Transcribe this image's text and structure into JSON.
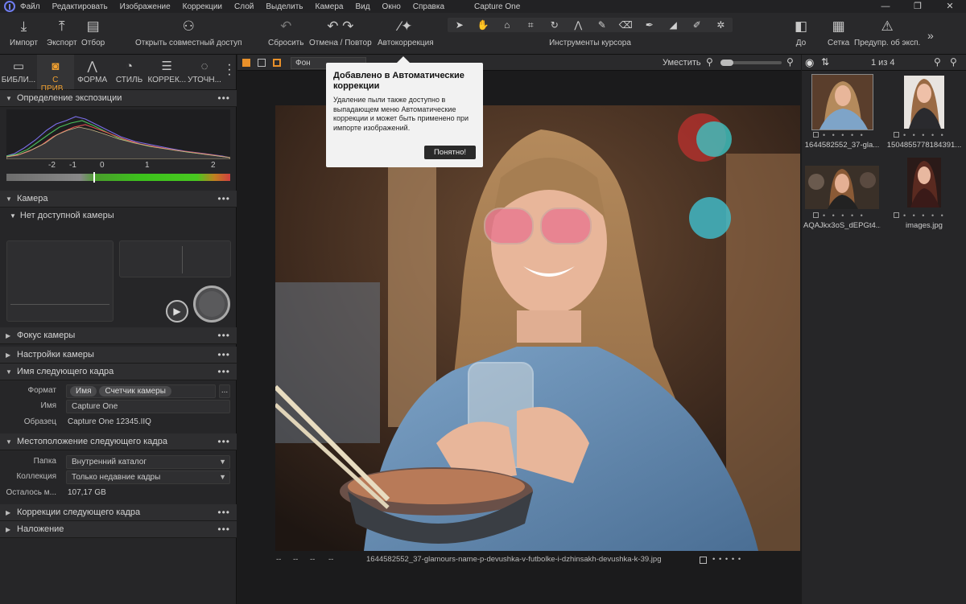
{
  "menu": [
    "Файл",
    "Редактировать",
    "Изображение",
    "Коррекции",
    "Слой",
    "Выделить",
    "Камера",
    "Вид",
    "Окно",
    "Справка"
  ],
  "app_title": "Capture One",
  "window_controls": [
    "—",
    "❐",
    "✕"
  ],
  "toolbar": {
    "import": "Импорт",
    "export": "Экспорт",
    "select": "Отбор",
    "share": "Открыть совместный доступ",
    "reset": "Сбросить",
    "undo_redo": "Отмена / Повтор",
    "autocorrect": "Автокоррекция",
    "cursor_tools": "Инструменты курсора",
    "before": "До",
    "grid": "Сетка",
    "exposure_warning": "Предупр. об эксп."
  },
  "tabs": [
    {
      "label": "БИБЛИ...",
      "icon": "folder-icon"
    },
    {
      "label": "С ПРИВ...",
      "icon": "camera-tether-icon"
    },
    {
      "label": "ФОРМА",
      "icon": "compass-icon"
    },
    {
      "label": "СТИЛЬ",
      "icon": "style-icon"
    },
    {
      "label": "КОРРЕК...",
      "icon": "sliders-icon"
    },
    {
      "label": "УТОЧН...",
      "icon": "refine-icon"
    }
  ],
  "sections": {
    "exposure": "Определение экспозиции",
    "camera": "Камера",
    "no_camera": "Нет доступной камеры",
    "focus": "Фокус камеры",
    "settings": "Настройки камеры",
    "next_name": "Имя следующего кадра",
    "next_location": "Местоположение следующего кадра",
    "next_adjust": "Коррекции следующего кадра",
    "overlay": "Наложение"
  },
  "hist_scale": [
    "-2",
    "-1",
    "0",
    "1",
    "2"
  ],
  "naming": {
    "format_label": "Формат",
    "format_pills": [
      "Имя",
      "Счетчик камеры"
    ],
    "format_more": "...",
    "name_label": "Имя",
    "name_value": "Capture One",
    "sample_label": "Образец",
    "sample_value": "Capture One 12345.IIQ"
  },
  "location": {
    "folder_label": "Папка",
    "folder_value": "Внутренний каталог",
    "collection_label": "Коллекция",
    "collection_value": "Только недавние кадры",
    "remaining_label": "Осталось м...",
    "remaining_value": "107,17 GB"
  },
  "viewer": {
    "layer": "Фон",
    "fit": "Уместить",
    "filename": "1644582552_37-glamours-name-p-devushka-v-futbolke-i-dzhinsakh-devushka-k-39.jpg",
    "meta": [
      "--",
      "--",
      "--",
      "--"
    ],
    "rating_dots": "• • • • •"
  },
  "popup": {
    "title": "Добавлено в Автоматические коррекции",
    "body": "Удаление пыли также доступно в выпадающем меню Автоматические коррекции и может быть применено при импорте изображений.",
    "button": "Понятно!"
  },
  "browser": {
    "count": "1 из 4",
    "thumbs": [
      {
        "name": "1644582552_37-gla...",
        "selected": true
      },
      {
        "name": "1504855778184391...",
        "selected": false
      },
      {
        "name": "AQAJkx3oS_dEPGt4...",
        "selected": false
      },
      {
        "name": "images.jpg",
        "selected": false
      }
    ],
    "rating_dots": "• • • • •"
  },
  "colors": {
    "accent": "#f0a030",
    "panel": "#262628",
    "toolbar": "#29292b",
    "popup": "#f2f2f2"
  }
}
